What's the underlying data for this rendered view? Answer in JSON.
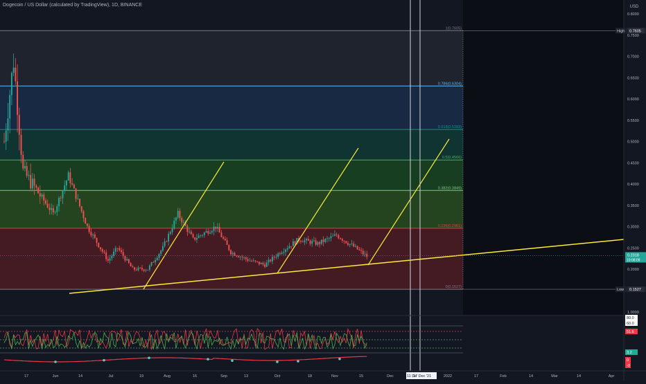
{
  "header": {
    "symbol_title": "Dogecoin / US Dollar (calculated by TradingView), 1D, BINANCE",
    "currency": "USD"
  },
  "price_axis": {
    "ticks": [
      "0.8000",
      "0.7500",
      "0.7000",
      "0.6500",
      "0.6000",
      "0.5500",
      "0.5000",
      "0.4500",
      "0.4000",
      "0.3500",
      "0.3000",
      "0.2500",
      "0.2000"
    ],
    "high_tag": {
      "label": "High",
      "value": "0.7605"
    },
    "low_tag": {
      "label": "Low",
      "value": "0.1527"
    },
    "last_price": {
      "value": "0.2318",
      "countdown": "10:08:09"
    }
  },
  "indicator_axis": {
    "ticks": [
      "1.0000"
    ],
    "tags": [
      {
        "value": "80.0",
        "color": "#ffffff",
        "text_color": "#131722"
      },
      {
        "value": "60.0",
        "color": "#ffffff",
        "text_color": "#131722"
      },
      {
        "value": "51.6",
        "color": "#f23645",
        "text_color": "#ffffff"
      },
      {
        "value": "3.2",
        "color": "#22ab94",
        "text_color": "#ffffff"
      },
      {
        "value": "0",
        "color": "#f23645",
        "text_color": "#ffffff"
      },
      {
        "value": "-0",
        "color": "#f23645",
        "text_color": "#ffffff"
      }
    ]
  },
  "time_axis": {
    "labels": [
      "17",
      "Jun",
      "14",
      "Jul",
      "19",
      "Aug",
      "16",
      "Sep",
      "13",
      "Oct",
      "18",
      "Nov",
      "15",
      "Dec",
      "2022",
      "17",
      "Feb",
      "14",
      "Mar",
      "14",
      "Apr"
    ],
    "cursor_labels": [
      "11 De",
      "17 Dec '21"
    ]
  },
  "fib_levels": [
    {
      "label": "1(0.7605)",
      "price": 0.7605,
      "fill": "#2a2e39",
      "line": "#787b86"
    },
    {
      "label": "0.786(0.6304)",
      "price": 0.6304,
      "fill": "#1e3a5f",
      "line": "#64b5f6"
    },
    {
      "label": "0.618(0.5283)",
      "price": 0.5283,
      "fill": "#0d4d40",
      "line": "#089981"
    },
    {
      "label": "0.5(0.4566)",
      "price": 0.4566,
      "fill": "#1b5e20",
      "line": "#4caf50"
    },
    {
      "label": "0.382(0.3849)",
      "price": 0.3849,
      "fill": "#33691e",
      "line": "#81c784"
    },
    {
      "label": "0.236(0.2961)",
      "price": 0.2961,
      "fill": "#6d1f24",
      "line": "#f23645"
    },
    {
      "label": "0(0.1527)",
      "price": 0.1527,
      "fill": "#6d1f24",
      "line": "#787b86"
    }
  ],
  "colors": {
    "up": "#26a69a",
    "down": "#ef5350",
    "trendline": "#ffeb3b",
    "channel": "#ffeb3b",
    "osc_a": "#f23645",
    "osc_b": "#4caf50"
  },
  "chart_data": {
    "type": "candlestick",
    "series_anchor_days": [
      {
        "day": 0,
        "price": 0.5
      },
      {
        "day": 5,
        "price": 0.69
      },
      {
        "day": 10,
        "price": 0.43
      },
      {
        "day": 18,
        "price": 0.38
      },
      {
        "day": 26,
        "price": 0.33
      },
      {
        "day": 34,
        "price": 0.42
      },
      {
        "day": 44,
        "price": 0.3
      },
      {
        "day": 55,
        "price": 0.22
      },
      {
        "day": 60,
        "price": 0.25
      },
      {
        "day": 68,
        "price": 0.2
      },
      {
        "day": 76,
        "price": 0.2
      },
      {
        "day": 84,
        "price": 0.25
      },
      {
        "day": 92,
        "price": 0.33
      },
      {
        "day": 100,
        "price": 0.27
      },
      {
        "day": 112,
        "price": 0.3
      },
      {
        "day": 120,
        "price": 0.24
      },
      {
        "day": 130,
        "price": 0.22
      },
      {
        "day": 138,
        "price": 0.21
      },
      {
        "day": 146,
        "price": 0.24
      },
      {
        "day": 156,
        "price": 0.27
      },
      {
        "day": 166,
        "price": 0.26
      },
      {
        "day": 176,
        "price": 0.28
      },
      {
        "day": 186,
        "price": 0.25
      },
      {
        "day": 192,
        "price": 0.23
      }
    ],
    "high": 0.7605,
    "low": 0.1527,
    "last": 0.2318
  }
}
